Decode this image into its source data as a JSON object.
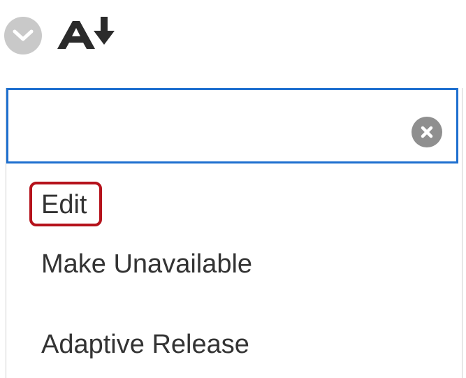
{
  "toolbar": {
    "expand_icon": "chevron-down-icon",
    "sort_icon": "text-sort-descending-icon"
  },
  "search": {
    "value": "",
    "placeholder": "",
    "clear_icon": "clear-x-icon"
  },
  "menu": {
    "items": [
      {
        "label": "Edit",
        "highlighted": true
      },
      {
        "label": "Make Unavailable",
        "highlighted": false
      },
      {
        "label": "Adaptive Release",
        "highlighted": false
      }
    ]
  },
  "colors": {
    "focus_border": "#1e6fcf",
    "highlight_border": "#b5121b",
    "icon_gray": "#c9c9c9",
    "text": "#333333",
    "sort_icon": "#2b2b2b"
  }
}
